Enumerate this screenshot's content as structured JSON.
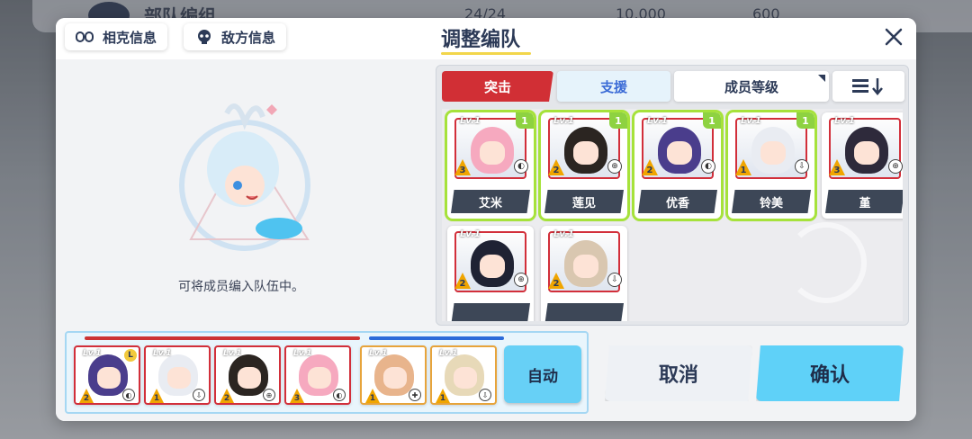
{
  "background": {
    "title": "部队编组",
    "resources": [
      "24/24",
      "10,000",
      "600"
    ]
  },
  "header": {
    "tab_counter_info": "相克信息",
    "tab_enemy_info": "敌方信息",
    "title": "调整编队"
  },
  "empty_state": {
    "text": "可将成员编入队伍中。"
  },
  "filter_tabs": {
    "assault": "突击",
    "support": "支援",
    "sort_level": "成员等级"
  },
  "roster": [
    {
      "name": "艾米",
      "level": "Lv.1",
      "star": "3",
      "badge": "1",
      "selected": true,
      "hair": "#f6a9bf",
      "role": "◐"
    },
    {
      "name": "莲见",
      "level": "Lv.1",
      "star": "2",
      "badge": "1",
      "selected": true,
      "hair": "#2b2521",
      "role": "⊕"
    },
    {
      "name": "优香",
      "level": "Lv.1",
      "star": "2",
      "badge": "1",
      "selected": true,
      "hair": "#4a3d8c",
      "role": "◐"
    },
    {
      "name": "铃美",
      "level": "Lv.1",
      "star": "1",
      "badge": "1",
      "selected": true,
      "hair": "#e9ecf2",
      "role": "⇩"
    },
    {
      "name": "堇",
      "level": "Lv.1",
      "star": "3",
      "badge": "",
      "selected": false,
      "hair": "#2e2a3b",
      "role": "⊕"
    },
    {
      "name": "",
      "level": "Lv.1",
      "star": "2",
      "badge": "",
      "selected": false,
      "hair": "#1f2233",
      "role": "⊕"
    },
    {
      "name": "",
      "level": "Lv.1",
      "star": "2",
      "badge": "",
      "selected": false,
      "hair": "#d9c7b0",
      "role": "⇩"
    }
  ],
  "formation": [
    {
      "level": "Lv.1",
      "star": "2",
      "hair": "#4a3d8c",
      "role": "◐",
      "leader": "L",
      "support": false
    },
    {
      "level": "Lv.1",
      "star": "1",
      "hair": "#e9ecf2",
      "role": "⇩",
      "leader": "",
      "support": false
    },
    {
      "level": "Lv.1",
      "star": "2",
      "hair": "#2b2521",
      "role": "⊕",
      "leader": "",
      "support": false
    },
    {
      "level": "Lv.1",
      "star": "3",
      "hair": "#f6a9bf",
      "role": "◐",
      "leader": "",
      "support": false
    },
    {
      "level": "Lv.1",
      "star": "1",
      "hair": "#e8b48c",
      "role": "✚",
      "leader": "",
      "support": true
    },
    {
      "level": "Lv.1",
      "star": "1",
      "hair": "#e7d9b8",
      "role": "⇩",
      "leader": "",
      "support": true
    }
  ],
  "buttons": {
    "auto": "自动",
    "cancel": "取消",
    "confirm": "确认"
  }
}
